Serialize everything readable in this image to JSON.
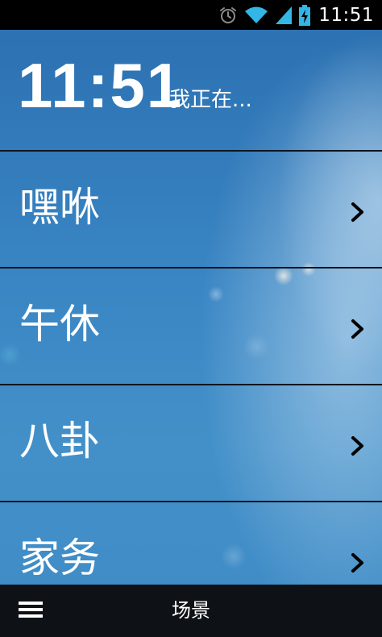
{
  "status_bar": {
    "time": "11:51",
    "icons": [
      "alarm-icon",
      "wifi-icon",
      "signal-icon",
      "battery-charging-icon"
    ]
  },
  "header": {
    "time": "11:51",
    "subtitle": "我正在..."
  },
  "scenes": [
    {
      "label": "嘿咻"
    },
    {
      "label": "午休"
    },
    {
      "label": "八卦"
    },
    {
      "label": "家务"
    }
  ],
  "bottom_bar": {
    "title": "场景",
    "menu_icon": "hamburger-menu-icon"
  },
  "colors": {
    "background": "#2a73b2",
    "status_bar": "#000000",
    "bottom_bar": "#0e1216",
    "divider": "#0d1620",
    "text": "#ffffff"
  }
}
